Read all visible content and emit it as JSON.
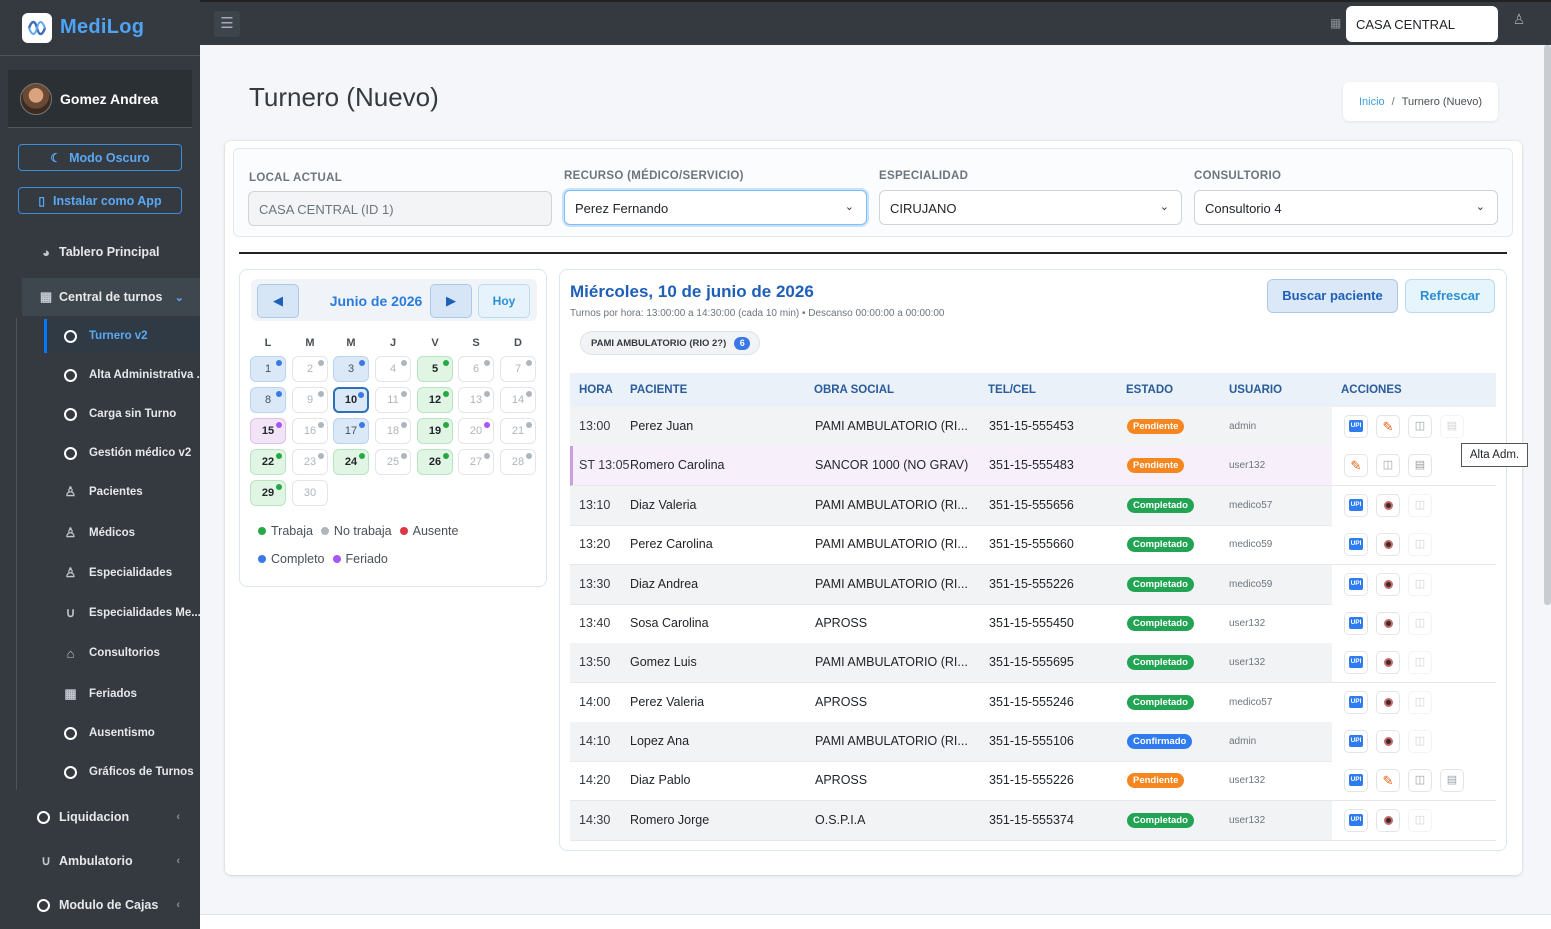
{
  "brand": {
    "name": "MediLog"
  },
  "user": {
    "name": "Gomez Andrea"
  },
  "sidebar": {
    "dark_mode": "Modo Oscuro",
    "install_app": "Instalar como App",
    "items": [
      {
        "label": "Tablero Principal",
        "icon": "gauge-icon"
      },
      {
        "label": "Central de turnos",
        "icon": "calendar-icon"
      },
      {
        "label": "Liquidacion",
        "icon": "circle-icon"
      },
      {
        "label": "Ambulatorio",
        "icon": "stethoscope-icon"
      },
      {
        "label": "Modulo de Cajas",
        "icon": "circle-icon"
      }
    ],
    "subitems": [
      {
        "label": "Turnero v2",
        "icon": "circle"
      },
      {
        "label": "Alta Administrativa ...",
        "icon": "circle"
      },
      {
        "label": "Carga sin Turno",
        "icon": "circle"
      },
      {
        "label": "Gestión médico v2",
        "icon": "circle"
      },
      {
        "label": "Pacientes",
        "icon": "user-icon"
      },
      {
        "label": "Médicos",
        "icon": "user-icon"
      },
      {
        "label": "Especialidades",
        "icon": "user-icon"
      },
      {
        "label": "Especialidades Me...",
        "icon": "stethoscope-icon"
      },
      {
        "label": "Consultorios",
        "icon": "clinic-icon"
      },
      {
        "label": "Feriados",
        "icon": "calendar-icon"
      },
      {
        "label": "Ausentismo",
        "icon": "circle"
      },
      {
        "label": "Gráficos de Turnos",
        "icon": "circle"
      }
    ]
  },
  "topbar": {
    "location": "CASA CENTRAL"
  },
  "page": {
    "title": "Turnero (Nuevo)",
    "breadcrumb": {
      "home": "Inicio",
      "sep": "/",
      "current": "Turnero (Nuevo)"
    }
  },
  "filters": {
    "local_label": "LOCAL ACTUAL",
    "local_value": "CASA CENTRAL  (ID 1)",
    "recurso_label": "RECURSO (MÉDICO/SERVICIO)",
    "recurso_value": "Perez Fernando",
    "especialidad_label": "ESPECIALIDAD",
    "especialidad_value": "CIRUJANO",
    "consultorio_label": "CONSULTORIO",
    "consultorio_value": "Consultorio 4"
  },
  "calendar": {
    "month": "Junio de 2026",
    "today_label": "Hoy",
    "weekdays": [
      "L",
      "M",
      "M",
      "J",
      "V",
      "S",
      "D"
    ],
    "days": [
      {
        "n": "1",
        "s": "blue"
      },
      {
        "n": "2",
        "s": "grey"
      },
      {
        "n": "3",
        "s": "blue"
      },
      {
        "n": "4",
        "s": "grey"
      },
      {
        "n": "5",
        "s": "green"
      },
      {
        "n": "6",
        "s": "grey"
      },
      {
        "n": "7",
        "s": "grey"
      },
      {
        "n": "8",
        "s": "blue"
      },
      {
        "n": "9",
        "s": "grey"
      },
      {
        "n": "10",
        "s": "selected"
      },
      {
        "n": "11",
        "s": "grey"
      },
      {
        "n": "12",
        "s": "green"
      },
      {
        "n": "13",
        "s": "grey"
      },
      {
        "n": "14",
        "s": "grey"
      },
      {
        "n": "15",
        "s": "purple"
      },
      {
        "n": "16",
        "s": "grey"
      },
      {
        "n": "17",
        "s": "blue"
      },
      {
        "n": "18",
        "s": "grey"
      },
      {
        "n": "19",
        "s": "green"
      },
      {
        "n": "20",
        "s": "grey-purple"
      },
      {
        "n": "21",
        "s": "grey"
      },
      {
        "n": "22",
        "s": "green"
      },
      {
        "n": "23",
        "s": "grey"
      },
      {
        "n": "24",
        "s": "green"
      },
      {
        "n": "25",
        "s": "grey"
      },
      {
        "n": "26",
        "s": "green"
      },
      {
        "n": "27",
        "s": "grey"
      },
      {
        "n": "28",
        "s": "grey"
      },
      {
        "n": "29",
        "s": "green"
      },
      {
        "n": "30",
        "s": "grey-nodot"
      }
    ],
    "legend": [
      {
        "label": "Trabaja",
        "color": "#28a745"
      },
      {
        "label": "No trabaja",
        "color": "#adb5bd"
      },
      {
        "label": "Ausente",
        "color": "#dc3545"
      },
      {
        "label": "Completo",
        "color": "#3b78e7"
      },
      {
        "label": "Feriado",
        "color": "#a855f7"
      }
    ]
  },
  "schedule": {
    "date_title": "Miércoles, 10 de junio de 2026",
    "subtitle": "Turnos por hora: 13:00:00 a 14:30:00 (cada 10 min) • Descanso 00:00:00 a 00:00:00",
    "search_button": "Buscar paciente",
    "refresh_button": "Refrescar",
    "chip_label": "PAMI AMBULATORIO (RIO 2?)",
    "chip_count": "6",
    "columns": [
      "HORA",
      "PACIENTE",
      "OBRA SOCIAL",
      "TEL/CEL",
      "ESTADO",
      "USUARIO",
      "ACCIONES"
    ],
    "rows": [
      {
        "hora": "13:00",
        "paciente": "Perez Juan",
        "obra": "PAMI AMBULATORIO (RI...",
        "tel": "351-15-555453",
        "estado": "Pendiente",
        "usuario": "admin"
      },
      {
        "hora": "ST 13:05",
        "paciente": "Romero Carolina",
        "obra": "SANCOR 1000 (NO GRAV)",
        "tel": "351-15-555483",
        "estado": "Pendiente",
        "usuario": "user132"
      },
      {
        "hora": "13:10",
        "paciente": "Diaz Valeria",
        "obra": "PAMI AMBULATORIO (RI...",
        "tel": "351-15-555656",
        "estado": "Completado",
        "usuario": "medico57"
      },
      {
        "hora": "13:20",
        "paciente": "Perez Carolina",
        "obra": "PAMI AMBULATORIO (RI...",
        "tel": "351-15-555660",
        "estado": "Completado",
        "usuario": "medico59"
      },
      {
        "hora": "13:30",
        "paciente": "Diaz Andrea",
        "obra": "PAMI AMBULATORIO (RI...",
        "tel": "351-15-555226",
        "estado": "Completado",
        "usuario": "medico59"
      },
      {
        "hora": "13:40",
        "paciente": "Sosa Carolina",
        "obra": "APROSS",
        "tel": "351-15-555450",
        "estado": "Completado",
        "usuario": "user132"
      },
      {
        "hora": "13:50",
        "paciente": "Gomez Luis",
        "obra": "PAMI AMBULATORIO (RI...",
        "tel": "351-15-555695",
        "estado": "Completado",
        "usuario": "user132"
      },
      {
        "hora": "14:00",
        "paciente": "Perez Valeria",
        "obra": "APROSS",
        "tel": "351-15-555246",
        "estado": "Completado",
        "usuario": "medico57"
      },
      {
        "hora": "14:10",
        "paciente": "Lopez Ana",
        "obra": "PAMI AMBULATORIO (RI...",
        "tel": "351-15-555106",
        "estado": "Confirmado",
        "usuario": "admin"
      },
      {
        "hora": "14:20",
        "paciente": "Diaz Pablo",
        "obra": "APROSS",
        "tel": "351-15-555226",
        "estado": "Pendiente",
        "usuario": "user132"
      },
      {
        "hora": "14:30",
        "paciente": "Romero Jorge",
        "obra": "O.S.P.I.A",
        "tel": "351-15-555374",
        "estado": "Completado",
        "usuario": "user132"
      }
    ],
    "upi_label": "UPI",
    "tooltip": "Alta Adm."
  },
  "colors": {
    "sidebar_bg": "#343a40",
    "accent": "#2a7be0",
    "pendiente": "#f6861f",
    "completado": "#23a455",
    "confirmado": "#2f7cf0"
  }
}
